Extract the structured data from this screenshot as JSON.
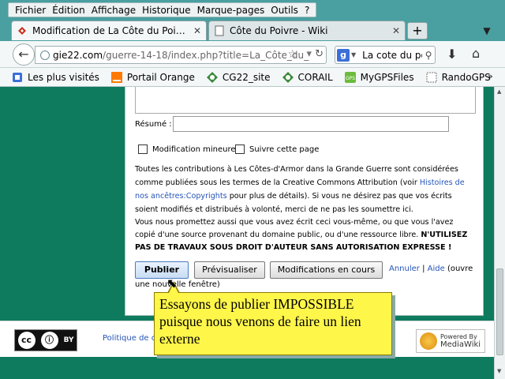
{
  "menu": [
    "Fichier",
    "Édition",
    "Affichage",
    "Historique",
    "Marque-pages",
    "Outils",
    "?"
  ],
  "tabs": [
    {
      "title": "Modification de La Côte du Poivre - L...",
      "close": "✕"
    },
    {
      "title": "Côte du Poivre - Wiki",
      "close": "✕"
    }
  ],
  "new_tab_label": "+",
  "tab_dropdown": "▼",
  "nav": {
    "back": "←",
    "url_host": "gie22.com",
    "url_path": "/guerre-14-18/index.php?title=La_Côte_du_",
    "search_text": "La cote du po",
    "download": "⬇",
    "home": "⌂"
  },
  "bookmarks": [
    {
      "label": "Les plus visités",
      "icon": "most-visited-icon",
      "color": "#3b6fd6"
    },
    {
      "label": "Portail Orange",
      "icon": "orange-icon",
      "color": "#ff7900"
    },
    {
      "label": "CG22_site",
      "icon": "cg22-icon",
      "color": "#3b8a3b"
    },
    {
      "label": "CORAIL",
      "icon": "corail-icon",
      "color": "#3b8a3b"
    },
    {
      "label": "MyGPSFiles",
      "icon": "mygpsfiles-icon",
      "color": "#6cbb3c"
    },
    {
      "label": "RandoGPS",
      "icon": "randogps-icon",
      "color": "#ffffff"
    }
  ],
  "form": {
    "summary_label": "Résumé :",
    "minor_edit_label": "Modification mineure",
    "watch_label": "Suivre cette page",
    "text1_a": "Toutes les contributions à Les Côtes-d'Armor dans la Grande Guerre sont considérées comme publiées sous les termes de la Creative Commons Attribution (voir ",
    "text1_link": "Histoires de nos ancêtres:Copyrights",
    "text1_b": " pour plus de détails). Si vous ne désirez pas que vos écrits soient modifiés et distribués à volonté, merci de ne pas les soumettre ici.",
    "text2_a": "Vous nous promettez aussi que vous avez écrit ceci vous-même, ou que vous l'avez copié d'une source provenant du domaine public, ou d'une ressource libre. ",
    "text2_bold": "N'UTILISEZ PAS DE TRAVAUX SOUS DROIT D'AUTEUR SANS AUTORISATION EXPRESSE !",
    "publish_button": "Publier",
    "preview_button": "Prévisualiser",
    "changes_button": "Modifications en cours",
    "cancel_link": "Annuler",
    "separator": " | ",
    "help_link": "Aide",
    "help_suffix": " (ouvre",
    "new_window_text": "une nouvelle fenêtre)"
  },
  "footer": {
    "policy_text": "Politique de c",
    "cc_label": "BY",
    "mediawiki_line1": "Powered By",
    "mediawiki_line2": "MediaWiki"
  },
  "callout": {
    "text": "Essayons de publier IMPOSSIBLE puisque nous venons de faire un lien externe"
  }
}
